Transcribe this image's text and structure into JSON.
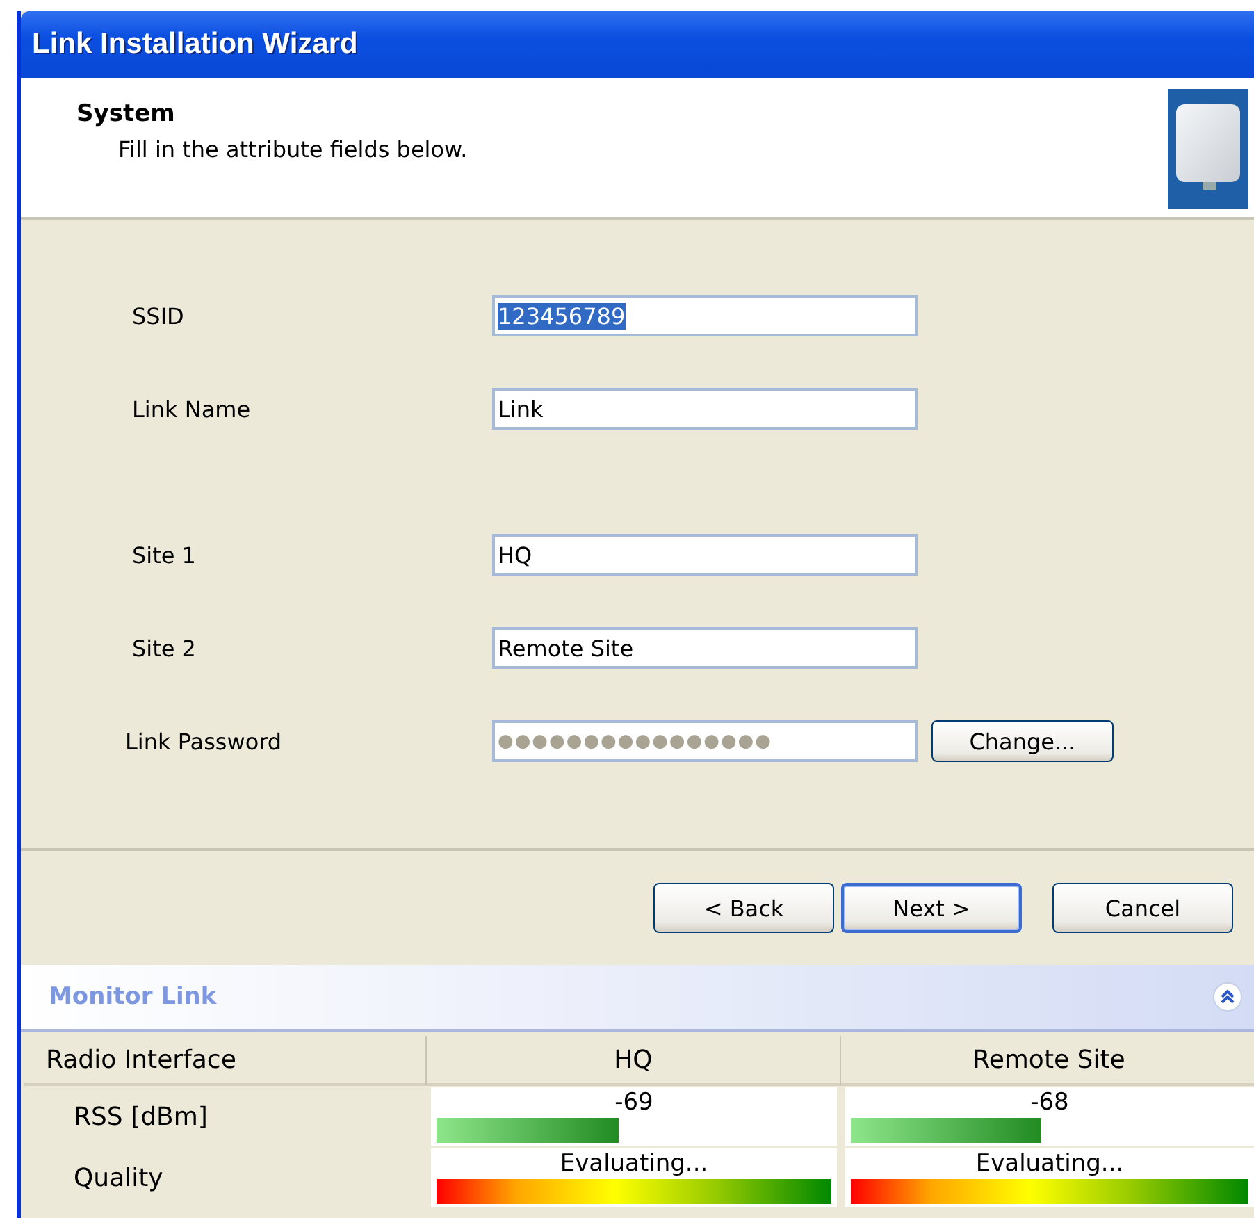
{
  "window": {
    "title": "Link Installation Wizard"
  },
  "header": {
    "title": "System",
    "subtitle": "Fill in the attribute fields below."
  },
  "field_groups": [
    {
      "fields": [
        {
          "kind": "text",
          "label": "SSID",
          "value": "123456789",
          "text_selected": true
        },
        {
          "kind": "text",
          "label": "Link Name",
          "value": "Link",
          "text_selected": false
        }
      ]
    },
    {
      "fields": [
        {
          "kind": "text",
          "label": "Site 1",
          "value": "HQ",
          "text_selected": false
        },
        {
          "kind": "text",
          "label": "Site 2",
          "value": "Remote Site",
          "text_selected": false
        },
        {
          "kind": "password",
          "label": "Link Password",
          "value": "●●●●●●●●●●●●●●●●",
          "text_selected": false,
          "button": "Change..."
        }
      ]
    }
  ],
  "buttons": [
    {
      "label": "< Back",
      "default": false
    },
    {
      "label": "Next >",
      "default": true
    },
    {
      "label": "Cancel",
      "default": false
    }
  ],
  "monitor": {
    "title": "Monitor Link",
    "expanded": true,
    "columns": [
      "Radio Interface",
      "HQ",
      "Remote Site"
    ],
    "rows": [
      {
        "cells": [
          {
            "kind": "label",
            "text": "RSS [dBm]"
          },
          {
            "kind": "meter",
            "reading": "-69",
            "level": 0.46
          },
          {
            "kind": "meter",
            "reading": "-68",
            "level": 0.48
          }
        ]
      },
      {
        "cells": [
          {
            "kind": "label",
            "text": "Quality"
          },
          {
            "kind": "scale",
            "reading": "Evaluating..."
          },
          {
            "kind": "scale",
            "reading": "Evaluating..."
          }
        ]
      }
    ]
  }
}
